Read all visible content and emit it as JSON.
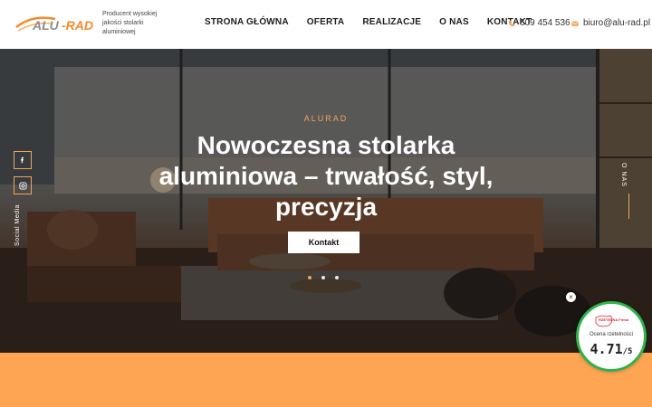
{
  "header": {
    "logo_tagline": "Producent wysokiej jakości stolarki aluminiowej",
    "nav": [
      "STRONA GŁÓWNA",
      "OFERTA",
      "REALIZACJE",
      "O NAS",
      "KONTAKT"
    ],
    "phone": "609 454 536",
    "email": "biuro@alu-rad.pl",
    "icons": [
      "phone-icon",
      "mail-icon"
    ]
  },
  "hero": {
    "eyebrow": "ALURAD",
    "headline": "Nowoczesna stolarka aluminiowa – trwałość, styl, precyzja",
    "cta_label": "Kontakt",
    "slides": 3,
    "active_slide": 1
  },
  "side": {
    "social_label": "Social Media",
    "social_icons": [
      "facebook-icon",
      "instagram-icon"
    ],
    "right_label": "O NAS"
  },
  "badge": {
    "brand": "RZETELNA Firma",
    "label": "Ocena rzetelności",
    "score": "4.71",
    "scale": "/5",
    "close": "×"
  },
  "colors": {
    "accent": "#f0a35a",
    "band": "#fda552",
    "badge_ring": "#2fb34a"
  }
}
